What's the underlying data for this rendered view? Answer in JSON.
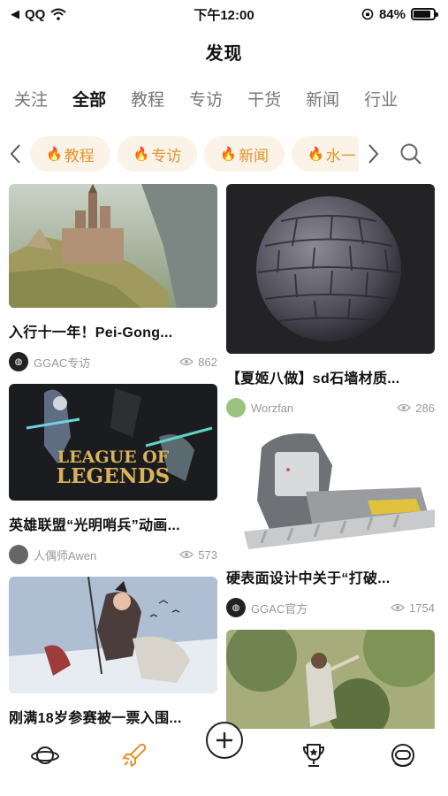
{
  "status_bar": {
    "carrier": "QQ",
    "time": "下午12:00",
    "battery": "84%"
  },
  "header": {
    "title": "发现"
  },
  "tabs": [
    {
      "label": "关注",
      "active": false
    },
    {
      "label": "全部",
      "active": true
    },
    {
      "label": "教程",
      "active": false
    },
    {
      "label": "专访",
      "active": false
    },
    {
      "label": "干货",
      "active": false
    },
    {
      "label": "新闻",
      "active": false
    },
    {
      "label": "行业",
      "active": false
    }
  ],
  "chips": [
    {
      "label": "教程",
      "icon": "flame-icon"
    },
    {
      "label": "专访",
      "icon": "flame-icon"
    },
    {
      "label": "新闻",
      "icon": "flame-icon"
    },
    {
      "label": "水一",
      "icon": "flame-icon"
    }
  ],
  "feed": {
    "left": [
      {
        "title": "入行十一年！Pei-Gong...",
        "author": "GGAC专访",
        "views": "862"
      },
      {
        "title": "英雄联盟“光明哨兵”动画...",
        "author": "人偶师Awen",
        "views": "573",
        "image_text_line1": "LEAGUE OF",
        "image_text_line2": "LEGENDS"
      },
      {
        "title": "刚满18岁参赛被一票入围..."
      }
    ],
    "right": [
      {
        "title": "【夏姬八做】sd石墙材质...",
        "author": "Worzfan",
        "views": "286"
      },
      {
        "title": "硬表面设计中关于“打破...",
        "author": "GGAC官方",
        "views": "1754"
      },
      {
        "title": ""
      }
    ]
  },
  "colors": {
    "accent": "#e3932e",
    "chip_bg": "#fbf3e7"
  },
  "bottom_nav": [
    "planet-icon",
    "rocket-icon",
    "add-icon",
    "trophy-icon",
    "astronaut-icon"
  ]
}
